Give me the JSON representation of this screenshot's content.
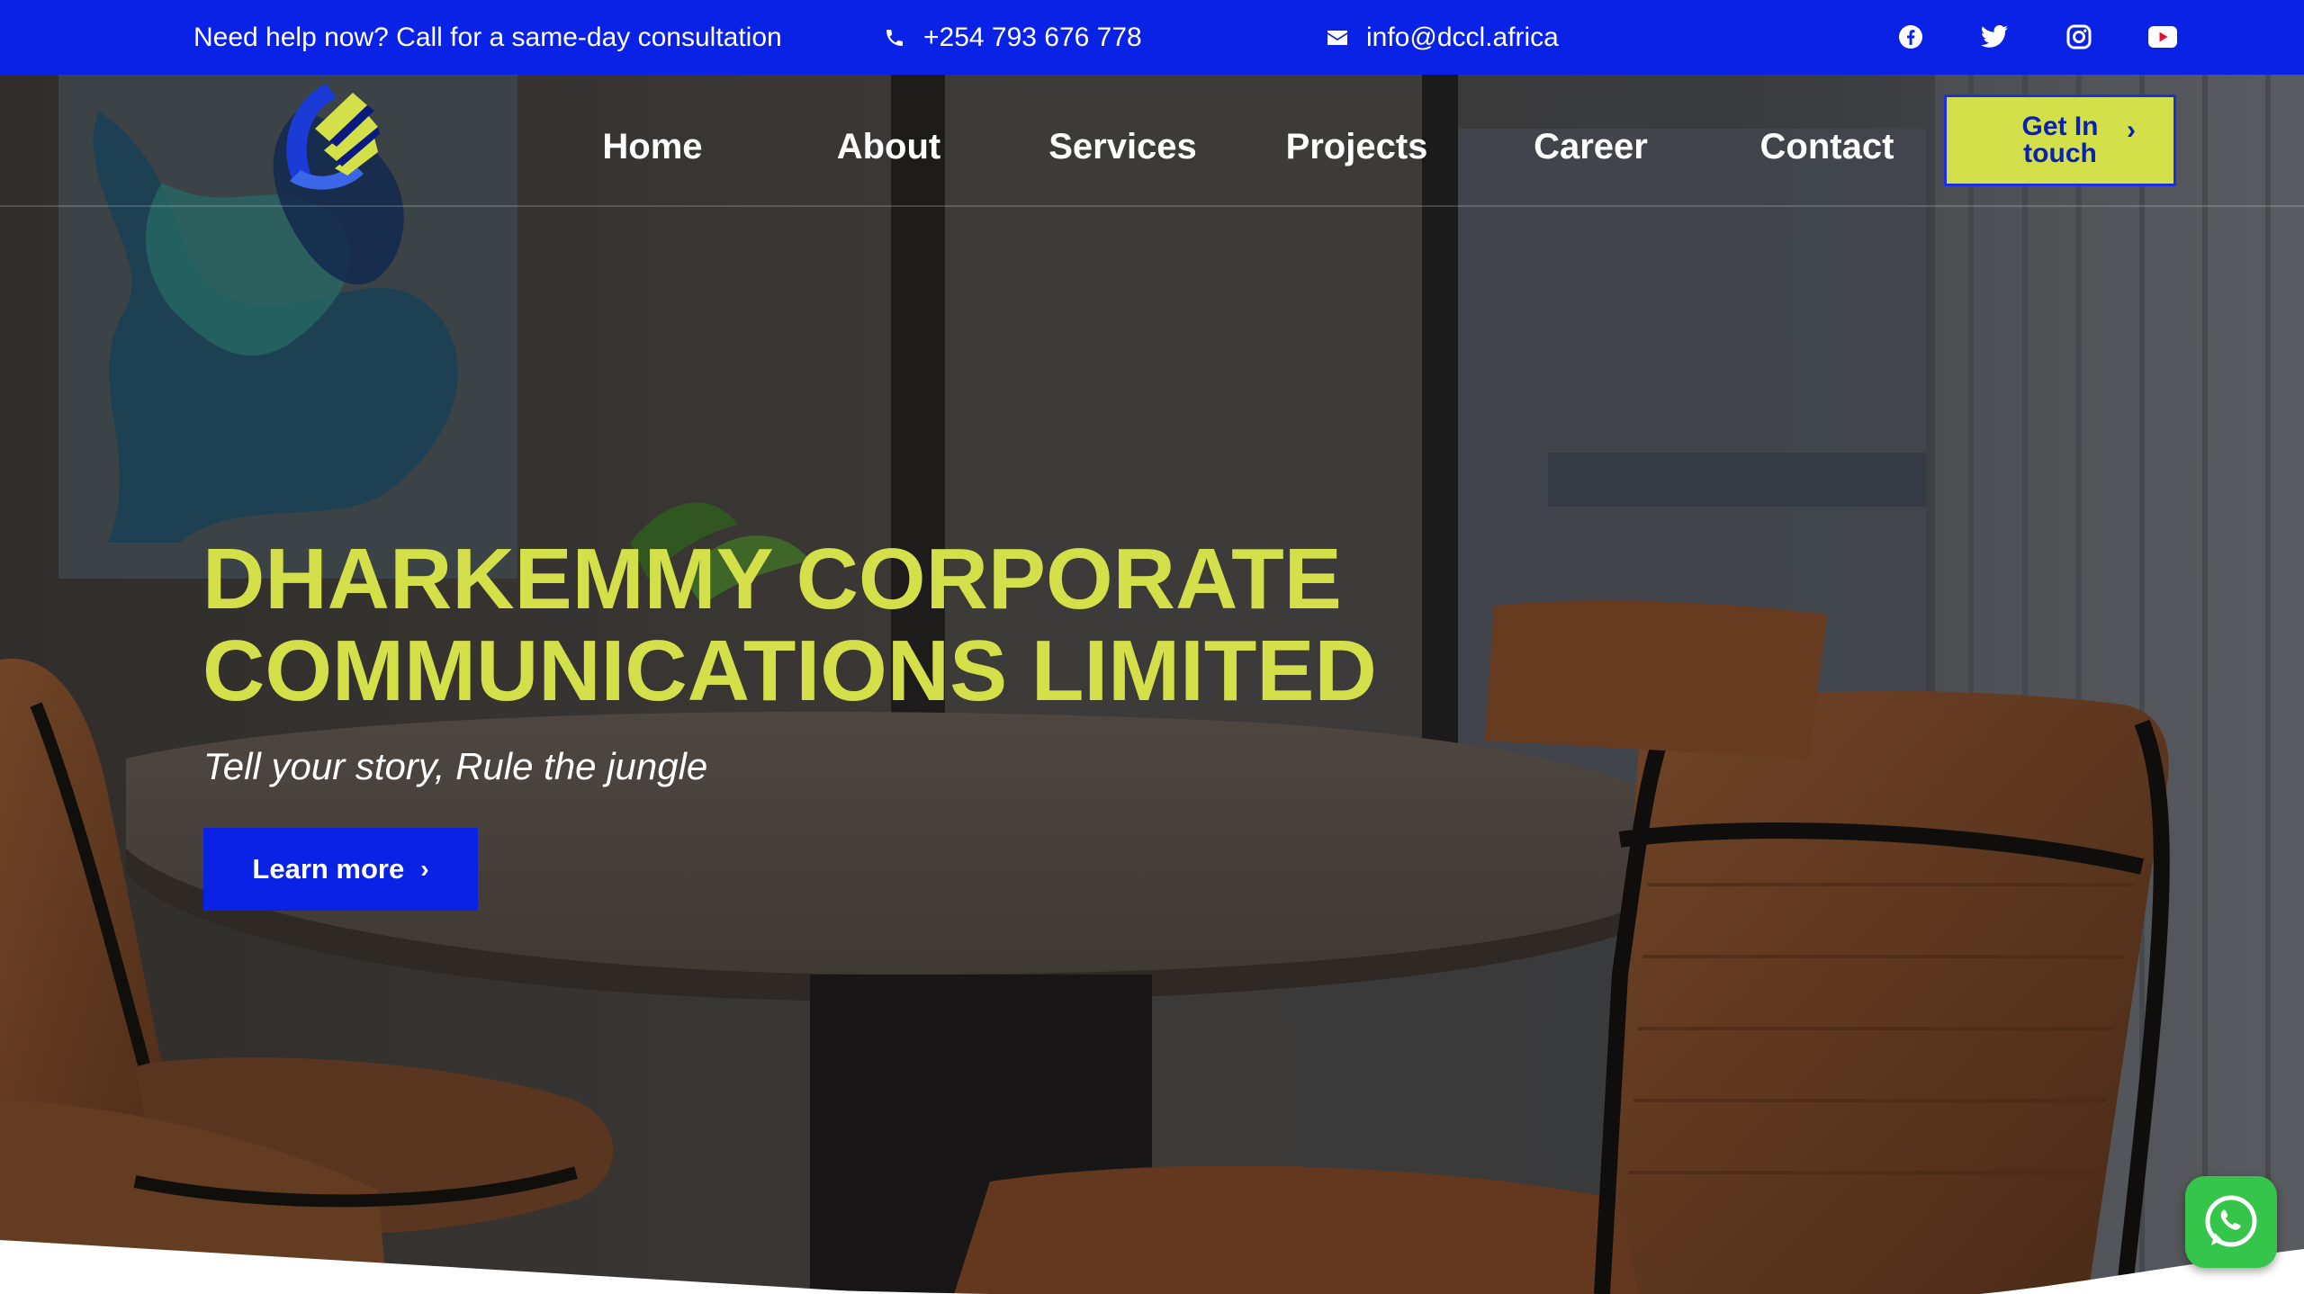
{
  "topbar": {
    "help_text": "Need help now? Call for a same-day consultation",
    "phone": "+254 793 676 778",
    "email": "info@dccl.africa",
    "phone_icon": "phone-icon",
    "email_icon": "mail-icon",
    "socials": [
      "facebook-icon",
      "twitter-icon",
      "instagram-icon",
      "youtube-icon"
    ],
    "background": "#0a22e6"
  },
  "nav": {
    "items": [
      {
        "label": "Home"
      },
      {
        "label": "About"
      },
      {
        "label": "Services"
      },
      {
        "label": "Projects"
      },
      {
        "label": "Career"
      },
      {
        "label": "Contact"
      }
    ],
    "cta_label": "Get In touch",
    "cta_color": "#d4e04a"
  },
  "hero": {
    "title_line1": "DHARKEMMY CORPORATE",
    "title_line2": "COMMUNICATIONS LIMITED",
    "subtitle": "Tell your story, Rule the jungle",
    "button_label": "Learn more",
    "title_color": "#d4e04a",
    "button_color": "#0a22e6"
  },
  "widgets": {
    "whatsapp_icon": "whatsapp-icon",
    "whatsapp_color": "#35c54a"
  }
}
